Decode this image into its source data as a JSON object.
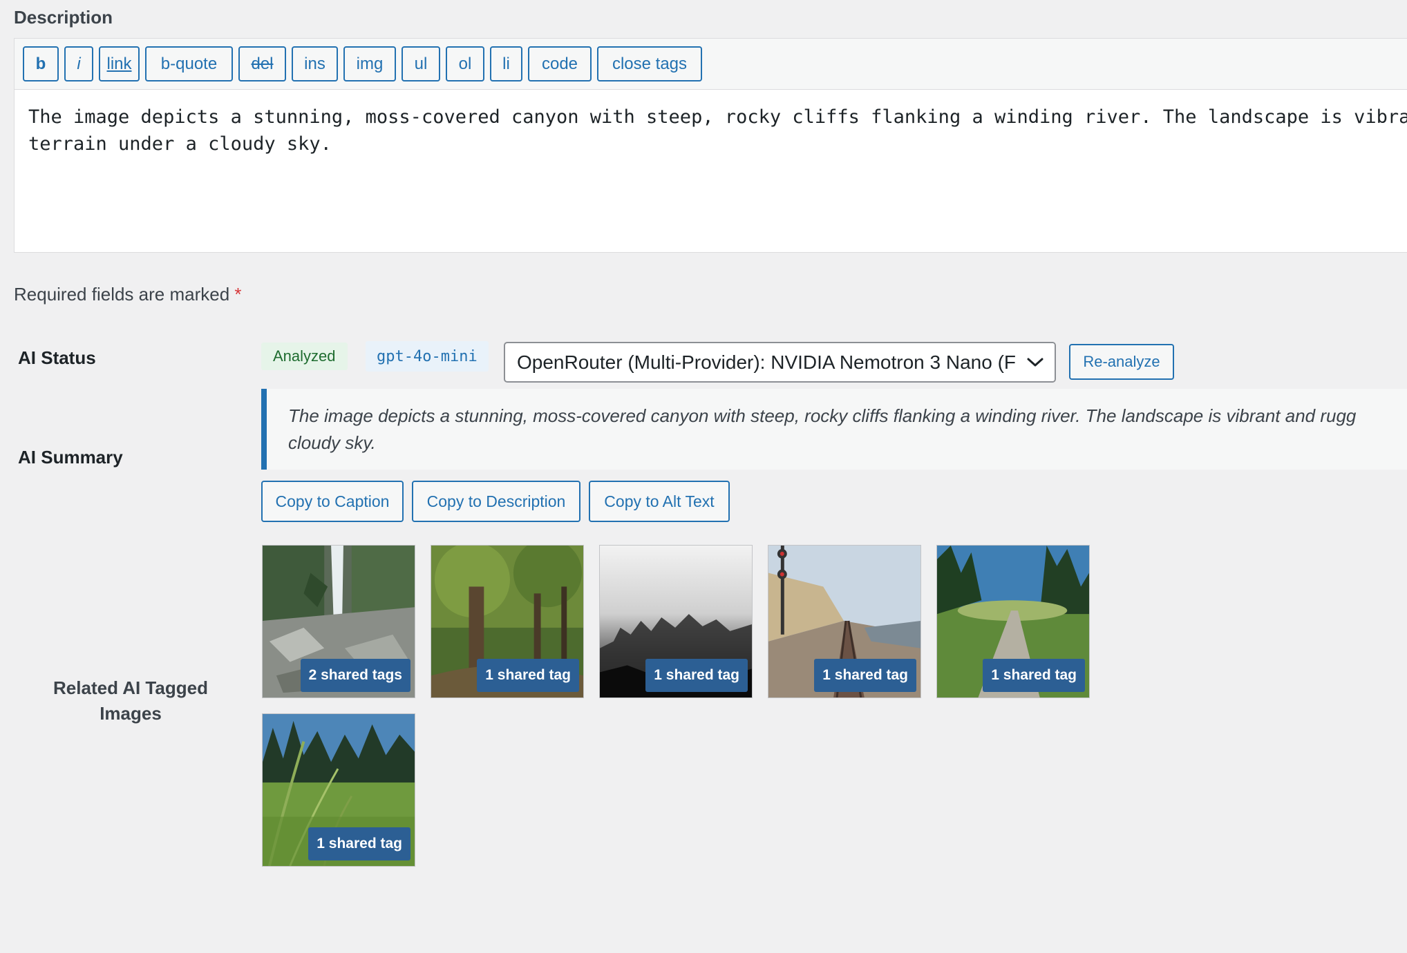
{
  "description": {
    "label": "Description",
    "quicktags": [
      "b",
      "i",
      "link",
      "b-quote",
      "del",
      "ins",
      "img",
      "ul",
      "ol",
      "li",
      "code",
      "close tags"
    ],
    "text_line1": "The image depicts a stunning, moss-covered canyon with steep, rocky cliffs flanking a winding river. The landscape is vibrant an",
    "text_line2": "terrain under a cloudy sky."
  },
  "required_note": {
    "text": "Required fields are marked",
    "star": "*"
  },
  "ai_status": {
    "label": "AI Status",
    "status_badge": "Analyzed",
    "model_badge": "gpt-4o-mini",
    "provider_select_value": "OpenRouter (Multi-Provider): NVIDIA Nemotron 3 Nano (F",
    "reanalyze_label": "Re-analyze"
  },
  "ai_summary": {
    "label": "AI Summary",
    "text_line1": "The image depicts a stunning, moss-covered canyon with steep, rocky cliffs flanking a winding river. The landscape is vibrant and rugg",
    "text_line2": "cloudy sky.",
    "buttons": [
      "Copy to Caption",
      "Copy to Description",
      "Copy to Alt Text"
    ]
  },
  "related": {
    "label_line1": "Related AI Tagged",
    "label_line2": "Images",
    "images": [
      {
        "scene": "waterfall",
        "badge": "2 shared tags"
      },
      {
        "scene": "forest",
        "badge": "1 shared tag"
      },
      {
        "scene": "city-fog",
        "badge": "1 shared tag"
      },
      {
        "scene": "railway",
        "badge": "1 shared tag"
      },
      {
        "scene": "path",
        "badge": "1 shared tag"
      },
      {
        "scene": "grass",
        "badge": "1 shared tag"
      }
    ]
  },
  "colors": {
    "accent": "#2271b1",
    "background": "#f0f0f1",
    "badge_bg": "#2c5f94",
    "analyzed_bg": "#e6f4e9",
    "analyzed_text": "#1e6c2f"
  }
}
